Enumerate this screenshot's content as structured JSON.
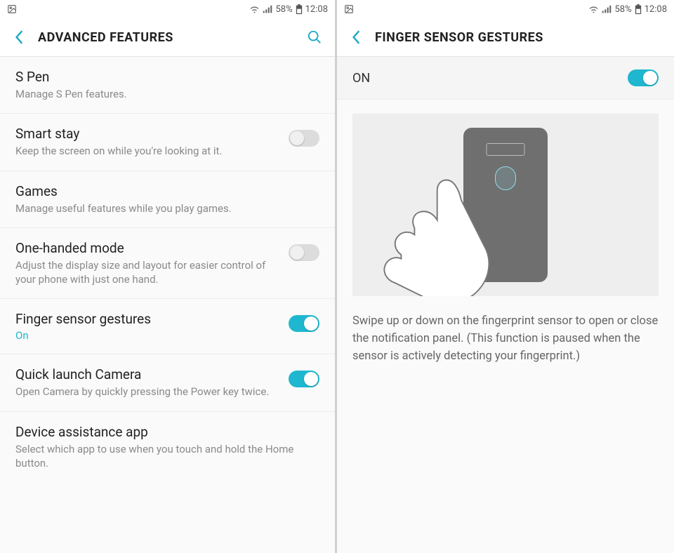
{
  "status": {
    "battery": "58%",
    "time": "12:08"
  },
  "left": {
    "title": "ADVANCED FEATURES",
    "items": [
      {
        "title": "S Pen",
        "sub": "Manage S Pen features.",
        "toggle": null
      },
      {
        "title": "Smart stay",
        "sub": "Keep the screen on while you're looking at it.",
        "toggle": "off"
      },
      {
        "title": "Games",
        "sub": "Manage useful features while you play games.",
        "toggle": null
      },
      {
        "title": "One-handed mode",
        "sub": "Adjust the display size and layout for easier control of your phone with just one hand.",
        "toggle": "off"
      },
      {
        "title": "Finger sensor gestures",
        "status": "On",
        "toggle": "on"
      },
      {
        "title": "Quick launch Camera",
        "sub": "Open Camera by quickly pressing the Power key twice.",
        "toggle": "on"
      },
      {
        "title": "Device assistance app",
        "sub": "Select which app to use when you touch and hold the Home button.",
        "toggle": null
      }
    ]
  },
  "right": {
    "title": "FINGER SENSOR GESTURES",
    "on_label": "ON",
    "toggle": "on",
    "description": "Swipe up or down on the fingerprint sensor to open or close the notification panel. (This function is paused when the sensor is actively detecting your fingerprint.)"
  }
}
